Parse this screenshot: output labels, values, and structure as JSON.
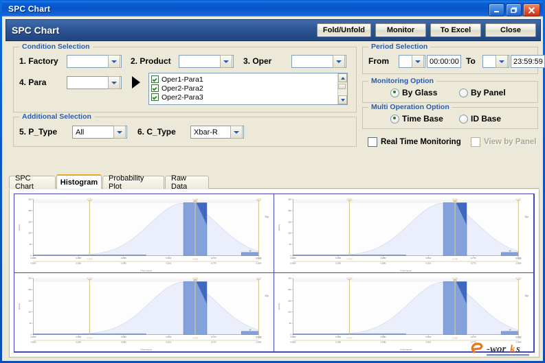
{
  "window": {
    "title": "SPC Chart",
    "controls": {
      "minimize": "–",
      "restore": "❐",
      "close": "✕"
    }
  },
  "header": {
    "title": "SPC Chart",
    "buttons": [
      {
        "label": "Fold/Unfold",
        "name": "fold-unfold-button"
      },
      {
        "label": "Monitor",
        "name": "monitor-button"
      },
      {
        "label": "To Excel",
        "name": "to-excel-button"
      },
      {
        "label": "Close",
        "name": "close-button"
      }
    ]
  },
  "condition_selection": {
    "legend": "Condition Selection",
    "factory": {
      "label": "1. Factory",
      "value": ""
    },
    "product": {
      "label": "2. Product",
      "value": ""
    },
    "oper": {
      "label": "3. Oper",
      "value": ""
    },
    "para": {
      "label": "4. Para",
      "value": ""
    },
    "param_list": [
      {
        "label": "Oper1-Para1",
        "checked": true
      },
      {
        "label": "Oper2-Para2",
        "checked": true
      },
      {
        "label": "Oper2-Para3",
        "checked": true
      }
    ]
  },
  "additional_selection": {
    "legend": "Additional Selection",
    "p_type": {
      "label": "5. P_Type",
      "value": "All"
    },
    "c_type": {
      "label": "6. C_Type",
      "value": "Xbar-R"
    }
  },
  "period_selection": {
    "legend": "Period Selection",
    "from_label": "From",
    "from_date": "",
    "from_time": "00:00:00",
    "to_label": "To",
    "to_date": "",
    "to_time": "23:59:59"
  },
  "monitoring_option": {
    "legend": "Monitoring Option",
    "options": [
      {
        "label": "By Glass",
        "selected": true
      },
      {
        "label": "By Panel",
        "selected": false
      }
    ]
  },
  "multi_operation_option": {
    "legend": "Multi Operation Option",
    "options": [
      {
        "label": "Time Base",
        "selected": true
      },
      {
        "label": "ID Base",
        "selected": false
      }
    ]
  },
  "checkboxes": [
    {
      "label": "Real Time Monitoring",
      "checked": false,
      "disabled": false
    },
    {
      "label": "View by Panel",
      "checked": false,
      "disabled": true
    }
  ],
  "tabs": [
    {
      "label": "SPC Chart",
      "active": false
    },
    {
      "label": "Histogram",
      "active": true
    },
    {
      "label": "Probability Plot",
      "active": false
    },
    {
      "label": "Raw Data",
      "active": false
    }
  ],
  "watermark": {
    "text_a": "e",
    "text_b": "-works"
  },
  "colors": {
    "accent_blue": "#2a5caa",
    "header_blue": "#2f5796",
    "titlebar_blue": "#0a5fd8",
    "tab_active_top": "#e3a72a",
    "bar_fill": "#7a9ad8",
    "bar_overlap": "#3a62bb",
    "curve_fill": "#eaeffb",
    "spec_line": "#d8c98a",
    "chart_border": "#4747b8",
    "window_face": "#ece9d8"
  },
  "chart_data": [
    {
      "type": "bar",
      "title": "",
      "xlabel": "X-Axis Interval",
      "ylabel": "Quantity",
      "categories": [
        "0.0000",
        "0.1500",
        "0.1883",
        "0.2000",
        "0.2310",
        "0.2770",
        "0.3000"
      ],
      "bins": [
        {
          "x0": 0.0,
          "x1": 0.15,
          "count": 3
        },
        {
          "x0": 0.2,
          "x1": 0.231,
          "count": 235
        },
        {
          "x0": 0.277,
          "x1": 0.3,
          "count": 14
        }
      ],
      "values": [
        3,
        235,
        14
      ],
      "ylim": [
        0,
        250
      ],
      "yticks": [
        "0",
        "50",
        "100",
        "150",
        "200",
        "250"
      ],
      "xticks": [
        "0.0000",
        "0.1500",
        "0.1883",
        "0.2310",
        "0.2770",
        "0.3000"
      ],
      "spec_lines": [
        {
          "name": "LSL",
          "x": 0.075,
          "label": "0.0750"
        },
        {
          "name": "Target",
          "x": 0.2155,
          "label": "0.2155"
        },
        {
          "name": "USL",
          "x": 0.3,
          "label": "0.3000"
        }
      ],
      "curve": {
        "type": "normal",
        "mean": 0.2,
        "label": "normal-distribution-curve"
      },
      "legend": "Cp",
      "grid": false
    },
    {
      "type": "bar",
      "title": "",
      "xlabel": "X-Axis Interval",
      "ylabel": "Quantity",
      "categories": [
        "0.0000",
        "0.1500",
        "0.1883",
        "0.2000",
        "0.2310",
        "0.2770",
        "0.3000"
      ],
      "bins": [
        {
          "x0": 0.0,
          "x1": 0.15,
          "count": 3
        },
        {
          "x0": 0.2,
          "x1": 0.231,
          "count": 235
        },
        {
          "x0": 0.277,
          "x1": 0.3,
          "count": 14
        }
      ],
      "values": [
        3,
        235,
        14
      ],
      "ylim": [
        0,
        250
      ],
      "yticks": [
        "0",
        "50",
        "100",
        "150",
        "200",
        "250"
      ],
      "xticks": [
        "0.0000",
        "0.1500",
        "0.1883",
        "0.2310",
        "0.2770",
        "0.3000"
      ],
      "spec_lines": [
        {
          "name": "LSL",
          "x": 0.075,
          "label": "0.0750"
        },
        {
          "name": "Target",
          "x": 0.2155,
          "label": "0.2155"
        },
        {
          "name": "USL",
          "x": 0.3,
          "label": "0.3000"
        }
      ],
      "curve": {
        "type": "normal",
        "mean": 0.2,
        "label": "normal-distribution-curve"
      },
      "legend": "Cp",
      "grid": false
    },
    {
      "type": "bar",
      "title": "",
      "xlabel": "X-Axis Interval",
      "ylabel": "Quantity",
      "categories": [
        "0.0000",
        "0.1500",
        "0.1883",
        "0.2000",
        "0.2310",
        "0.2770",
        "0.3000"
      ],
      "bins": [
        {
          "x0": 0.0,
          "x1": 0.15,
          "count": 3
        },
        {
          "x0": 0.2,
          "x1": 0.231,
          "count": 235
        },
        {
          "x0": 0.277,
          "x1": 0.3,
          "count": 14
        }
      ],
      "values": [
        3,
        235,
        14
      ],
      "ylim": [
        0,
        250
      ],
      "yticks": [
        "0",
        "50",
        "100",
        "150",
        "200",
        "250"
      ],
      "xticks": [
        "0.0000",
        "0.1500",
        "0.1883",
        "0.2310",
        "0.2770",
        "0.3000"
      ],
      "spec_lines": [
        {
          "name": "LSL",
          "x": 0.075,
          "label": "0.0750"
        },
        {
          "name": "Target",
          "x": 0.2155,
          "label": "0.2155"
        },
        {
          "name": "USL",
          "x": 0.3,
          "label": "0.3000"
        }
      ],
      "curve": {
        "type": "normal",
        "mean": 0.2,
        "label": "normal-distribution-curve"
      },
      "legend": "Cp",
      "grid": false
    },
    {
      "type": "bar",
      "title": "",
      "xlabel": "X-Axis Interval",
      "ylabel": "Quantity",
      "categories": [
        "0.0000",
        "0.1500",
        "0.1883",
        "0.2000",
        "0.2310",
        "0.2770",
        "0.3000"
      ],
      "bins": [
        {
          "x0": 0.0,
          "x1": 0.15,
          "count": 3
        },
        {
          "x0": 0.2,
          "x1": 0.231,
          "count": 235
        },
        {
          "x0": 0.277,
          "x1": 0.3,
          "count": 14
        }
      ],
      "values": [
        3,
        235,
        14
      ],
      "ylim": [
        0,
        250
      ],
      "yticks": [
        "0",
        "50",
        "100",
        "150",
        "200",
        "250"
      ],
      "xticks": [
        "0.0000",
        "0.1500",
        "0.1883",
        "0.2310",
        "0.2770",
        "0.3000"
      ],
      "spec_lines": [
        {
          "name": "LSL",
          "x": 0.075,
          "label": "0.0750"
        },
        {
          "name": "Target",
          "x": 0.2155,
          "label": "0.2155"
        },
        {
          "name": "USL",
          "x": 0.3,
          "label": "0.3000"
        }
      ],
      "curve": {
        "type": "normal",
        "mean": 0.2,
        "label": "normal-distribution-curve"
      },
      "legend": "Cp",
      "grid": false
    }
  ]
}
